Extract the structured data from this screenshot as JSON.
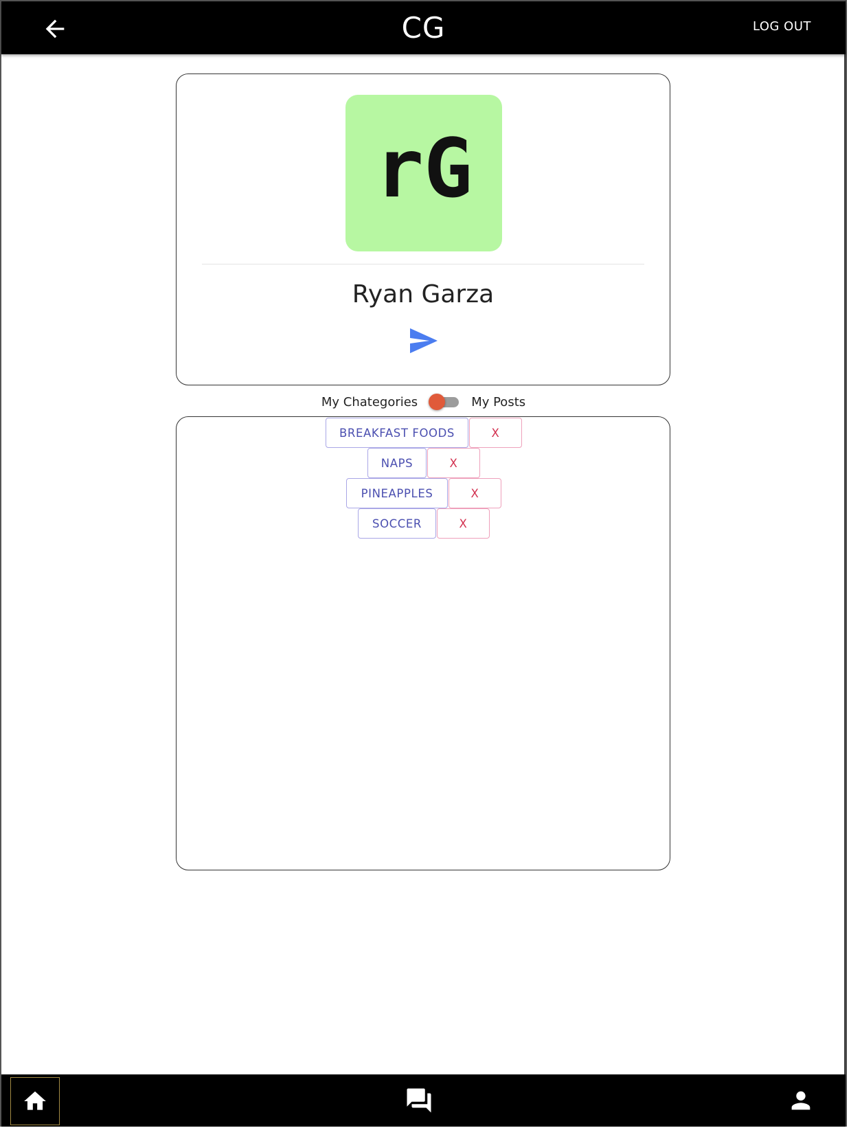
{
  "header": {
    "title": "CG",
    "logout_label": "LOG OUT"
  },
  "profile": {
    "avatar_text": "rG",
    "avatar_color": "#b7f7a2",
    "name": "Ryan Garza"
  },
  "view_toggle": {
    "left_label": "My Chategories",
    "right_label": "My Posts",
    "state": "My Chategories"
  },
  "categories": [
    {
      "label": "BREAKFAST FOODS",
      "remove_label": "X"
    },
    {
      "label": "NAPS",
      "remove_label": "X"
    },
    {
      "label": "PINEAPPLES",
      "remove_label": "X"
    },
    {
      "label": "SOCCER",
      "remove_label": "X"
    }
  ],
  "bottom_nav": {
    "items": [
      {
        "icon": "home-icon",
        "active": true
      },
      {
        "icon": "chat-icon",
        "active": false
      },
      {
        "icon": "person-icon",
        "active": false
      }
    ]
  },
  "colors": {
    "accent_blue": "#4b7df0",
    "category_text": "#4b4fb0",
    "remove_text": "#d2304f",
    "toggle_thumb": "#e05a3a"
  }
}
